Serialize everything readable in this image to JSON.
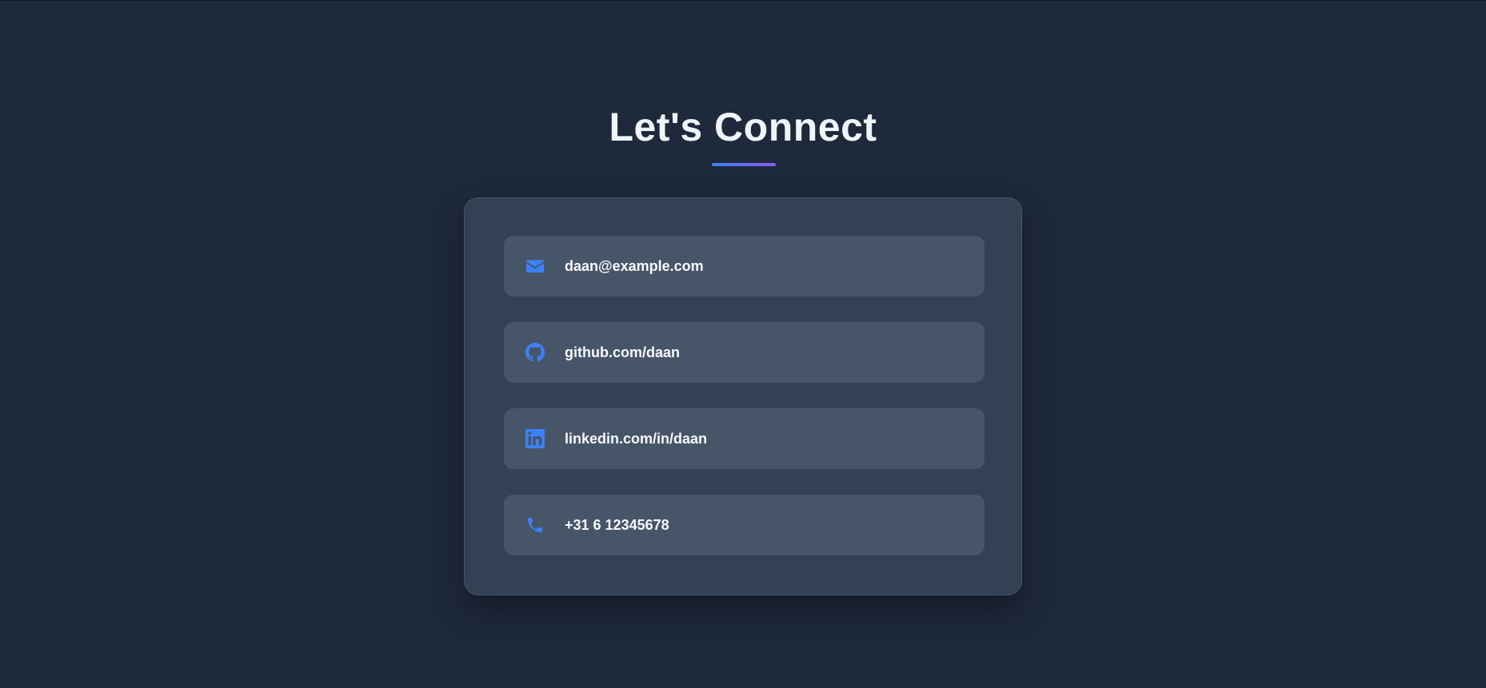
{
  "heading": {
    "title": "Let's Connect"
  },
  "theme": {
    "background": "#1e293b",
    "card": "#334155",
    "item": "#475569",
    "accent": "#3b82f6",
    "accent_gradient_end": "#8b5cf6"
  },
  "contacts": [
    {
      "icon": "envelope-icon",
      "text": "daan@example.com"
    },
    {
      "icon": "github-icon",
      "text": "github.com/daan"
    },
    {
      "icon": "linkedin-icon",
      "text": "linkedin.com/in/daan"
    },
    {
      "icon": "phone-icon",
      "text": "+31 6 12345678"
    }
  ]
}
